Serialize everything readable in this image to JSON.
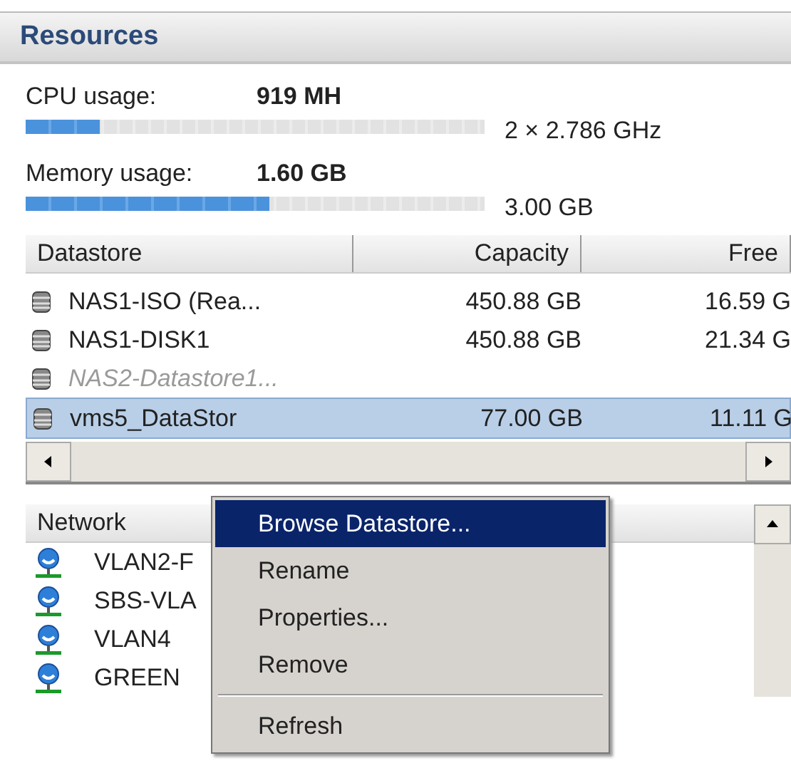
{
  "section": {
    "title": "Resources"
  },
  "meters": [
    {
      "label": "CPU usage:",
      "value": "919 MH",
      "level": 0.16,
      "capacity": "2 × 2.786 GHz"
    },
    {
      "label": "Memory usage:",
      "value": "1.60 GB",
      "level": 0.53,
      "capacity": "3.00 GB"
    }
  ],
  "datastores": {
    "columns": [
      "Datastore",
      "Capacity",
      "Free"
    ],
    "rows": [
      {
        "name": "NAS1-ISO (Rea...",
        "capacity": "450.88 GB",
        "free": "16.59 G",
        "inaccessible": false,
        "selected": false
      },
      {
        "name": "NAS1-DISK1",
        "capacity": "450.88 GB",
        "free": "21.34 G",
        "inaccessible": false,
        "selected": false
      },
      {
        "name": "NAS2-Datastore1...",
        "inaccessible": true,
        "selected": false
      },
      {
        "name": "vms5_DataStor",
        "capacity": "77.00 GB",
        "free": "11.11 G",
        "inaccessible": false,
        "selected": true
      }
    ]
  },
  "network": {
    "title": "Network",
    "items": [
      "VLAN2-F",
      "SBS-VLA",
      "VLAN4",
      "GREEN"
    ]
  },
  "context_menu": {
    "items": [
      {
        "kind": "item",
        "label": "Browse Datastore...",
        "selected": true
      },
      {
        "kind": "item",
        "label": "Rename",
        "selected": false
      },
      {
        "kind": "item",
        "label": "Properties...",
        "selected": false
      },
      {
        "kind": "item",
        "label": "Remove",
        "selected": false
      },
      {
        "kind": "separator"
      },
      {
        "kind": "item",
        "label": "Refresh",
        "selected": false
      }
    ]
  }
}
